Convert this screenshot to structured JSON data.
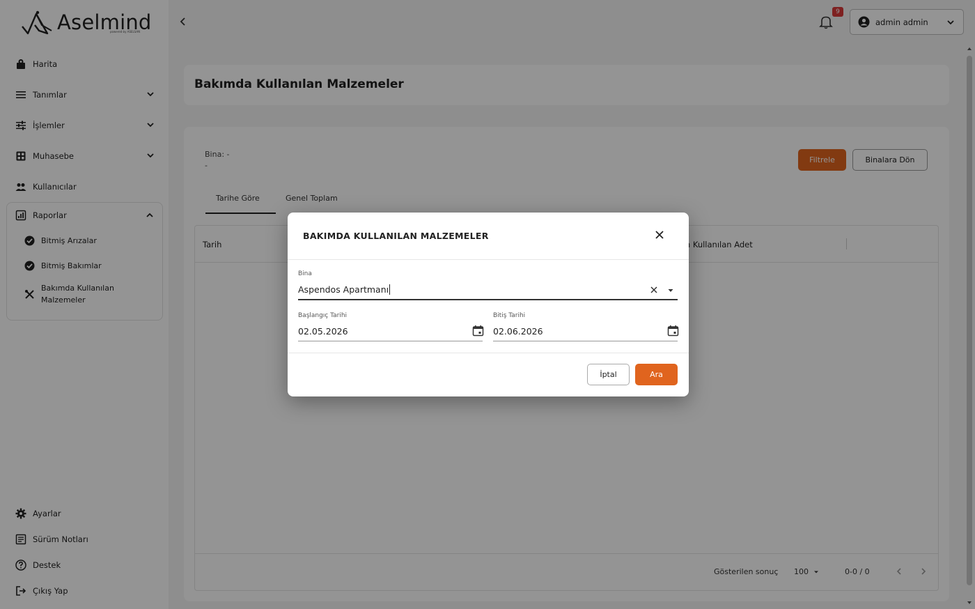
{
  "app": {
    "logo_text": "Aselmind",
    "logo_sub": "powered by ASELSAN"
  },
  "sidebar": {
    "items": [
      {
        "label": "Harita",
        "icon": "map-pin-icon",
        "expandable": false
      },
      {
        "label": "Tanımlar",
        "icon": "list-icon",
        "expandable": true
      },
      {
        "label": "İşlemler",
        "icon": "sliders-icon",
        "expandable": true
      },
      {
        "label": "Muhasebe",
        "icon": "calculator-icon",
        "expandable": true
      },
      {
        "label": "Kullanıcılar",
        "icon": "users-icon",
        "expandable": false
      }
    ],
    "reports": {
      "label": "Raporlar",
      "icon": "report-icon",
      "expanded": true,
      "subitems": [
        {
          "label": "Bitmiş Arızalar",
          "icon": "check-circle-icon"
        },
        {
          "label": "Bitmiş Bakımlar",
          "icon": "check-circle-icon"
        },
        {
          "label_line1": "Bakımda Kullanılan",
          "label_line2": "Malzemeler",
          "icon": "tools-icon"
        }
      ]
    },
    "bottom_items": [
      {
        "label": "Ayarlar",
        "icon": "gear-icon"
      },
      {
        "label": "Sürüm Notları",
        "icon": "notes-icon"
      },
      {
        "label": "Destek",
        "icon": "help-icon"
      },
      {
        "label": "Çıkış Yap",
        "icon": "logout-icon"
      }
    ]
  },
  "topbar": {
    "notification_count": "9",
    "user_label": "admin admin"
  },
  "page": {
    "title": "Bakımda Kullanılan Malzemeler",
    "bina_label": "Bina: -",
    "bina_value": "-",
    "filter_button": "Filtrele",
    "back_button": "Binalara Dön",
    "tabs": [
      "Tarihe Göre",
      "Genel Toplam"
    ],
    "active_tab": 0,
    "table": {
      "columns": [
        "Tarih",
        "Bakımda Kullanılan Adet"
      ],
      "visible_header_right": "m Kullanılan Adet",
      "rows": []
    },
    "paginator": {
      "label": "Gösterilen sonuç",
      "page_size": "100",
      "range": "0-0 / 0"
    }
  },
  "dialog": {
    "title": "BAKIMDA KULLANILAN MALZEMELER",
    "bina": {
      "label": "Bina",
      "value": "Aspendos Apartmanı"
    },
    "start_date": {
      "label": "Başlangıç Tarihi",
      "value": "02.05.2026"
    },
    "end_date": {
      "label": "Bitiş Tarihi",
      "value": "02.06.2026"
    },
    "cancel_button": "İptal",
    "search_button": "Ara"
  },
  "colors": {
    "accent": "#e0641e",
    "badge": "#d93a3a",
    "overlay": "rgba(0,0,0,0.42)"
  }
}
